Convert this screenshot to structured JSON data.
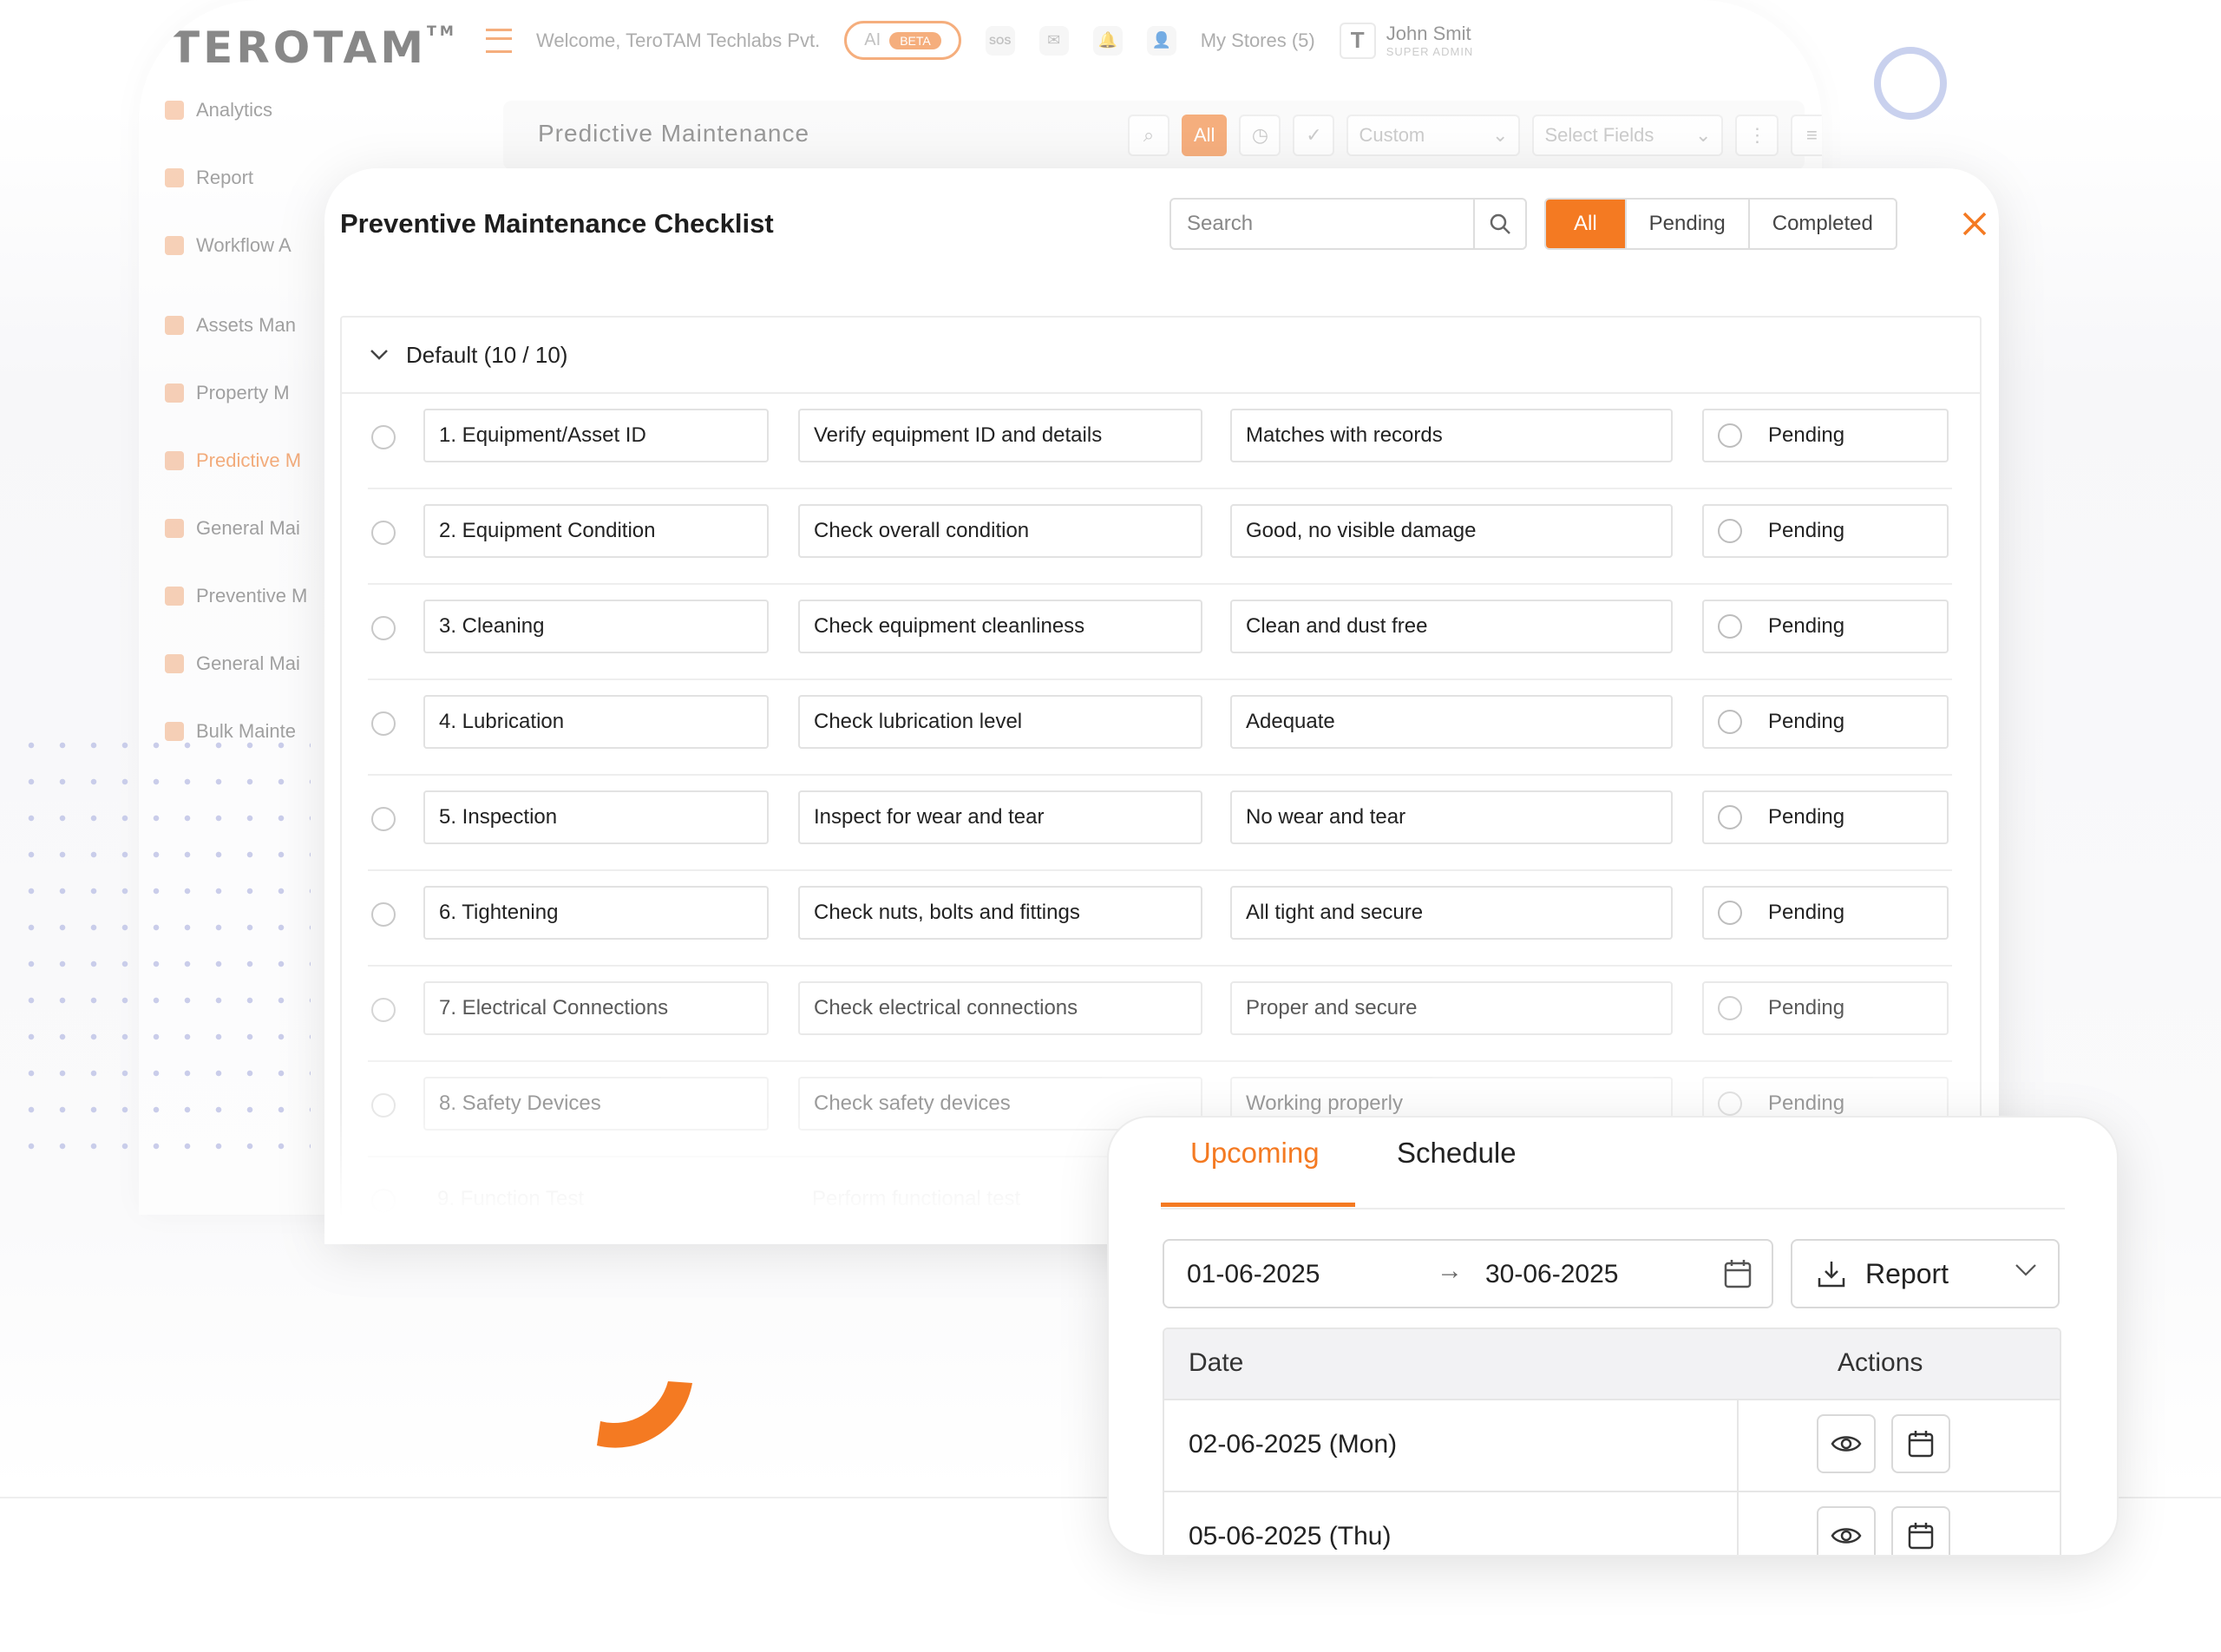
{
  "background_app": {
    "logo": "TEROTAM",
    "welcome": "Welcome, TeroTAM Techlabs Pvt.",
    "ai_label": "AI",
    "ai_badge": "BETA",
    "sos_label": "SOS",
    "stores_label": "My Stores (5)",
    "user_name": "John Smit",
    "user_role": "SUPER ADMIN",
    "sidebar": [
      {
        "label": "Analytics"
      },
      {
        "label": "Report"
      },
      {
        "label": "Workflow A"
      },
      {
        "label": "Assets Man"
      },
      {
        "label": "Property M"
      },
      {
        "label": "Predictive M",
        "active": true
      },
      {
        "label": "General Mai"
      },
      {
        "label": "Preventive M"
      },
      {
        "label": "General Mai"
      },
      {
        "label": "Bulk Mainte"
      }
    ],
    "page_title": "Predictive Maintenance",
    "filter_all": "All",
    "custom_label": "Custom",
    "select_fields": "Select Fields",
    "add_label": "+"
  },
  "modal": {
    "title": "Preventive Maintenance Checklist",
    "search_placeholder": "Search",
    "filters": [
      "All",
      "Pending",
      "Completed"
    ],
    "group_title": "Default (10 / 10)",
    "rows": [
      {
        "item": "1. Equipment/Asset ID",
        "check": "Verify equipment ID and details",
        "expected": "Matches with records",
        "status": "Pending"
      },
      {
        "item": "2. Equipment Condition",
        "check": "Check overall condition",
        "expected": "Good, no visible damage",
        "status": "Pending"
      },
      {
        "item": "3. Cleaning",
        "check": "Check equipment cleanliness",
        "expected": "Clean and dust free",
        "status": "Pending"
      },
      {
        "item": "4. Lubrication",
        "check": "Check lubrication level",
        "expected": "Adequate",
        "status": "Pending"
      },
      {
        "item": "5. Inspection",
        "check": "Inspect for wear and tear",
        "expected": "No wear and tear",
        "status": "Pending"
      },
      {
        "item": "6. Tightening",
        "check": "Check nuts, bolts and fittings",
        "expected": "All tight and secure",
        "status": "Pending"
      },
      {
        "item": "7. Electrical Connections",
        "check": "Check electrical connections",
        "expected": "Proper and secure",
        "status": "Pending"
      },
      {
        "item": "8. Safety Devices",
        "check": "Check safety devices",
        "expected": "Working properly",
        "status": "Pending"
      },
      {
        "item": "9. Function Test",
        "check": "Perform functional test",
        "expected": "",
        "status": ""
      }
    ]
  },
  "schedule_card": {
    "tabs": [
      "Upcoming",
      "Schedule"
    ],
    "start_date": "01-06-2025",
    "end_date": "30-06-2025",
    "report_label": "Report",
    "col_date": "Date",
    "col_actions": "Actions",
    "dates": [
      "02-06-2025 (Mon)",
      "05-06-2025 (Thu)"
    ]
  },
  "colors": {
    "accent": "#f47a22",
    "ring": "#c9d1ee",
    "dots": "#c4c8e8"
  }
}
